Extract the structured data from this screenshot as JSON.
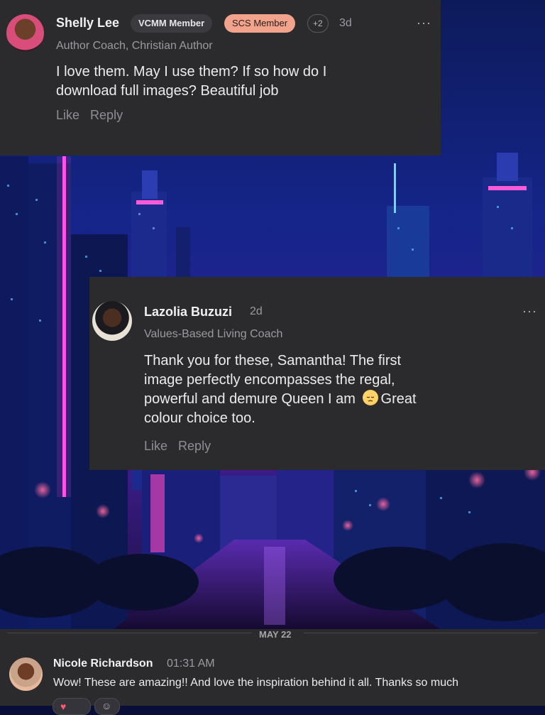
{
  "comments": [
    {
      "name": "Shelly Lee",
      "badges": [
        "VCMM Member",
        "SCS Member",
        "+2"
      ],
      "time": "3d",
      "role": "Author Coach, Christian Author",
      "text_lines": [
        "I love them. May I use them? If so how do I",
        "download full images? Beautiful job"
      ],
      "like": "Like",
      "reply": "Reply",
      "more": "···"
    },
    {
      "name": "Lazolia Buzuzi",
      "time": "2d",
      "role": "Values-Based Living Coach",
      "text_lines": [
        "Thank you for these, Samantha! The first",
        "image perfectly encompasses the regal,",
        "powerful and demure Queen I am",
        "Great",
        "colour choice too."
      ],
      "emoji": "pensive-face-emoji",
      "like": "Like",
      "reply": "Reply",
      "more": "···"
    }
  ],
  "chat": {
    "date_separator": "MAY 22",
    "message": {
      "name": "Nicole Richardson",
      "time": "01:31 AM",
      "text": "Wow! These are amazing!! And love the inspiration behind it all. Thanks so much"
    }
  },
  "background": {
    "description_icon": "neon-city-image"
  },
  "colors": {
    "card_bg": "#2b2b2e",
    "peach_badge": "#f2a38c",
    "neon_pink": "#ff4fe0",
    "neon_cyan": "#7fe8ff"
  }
}
